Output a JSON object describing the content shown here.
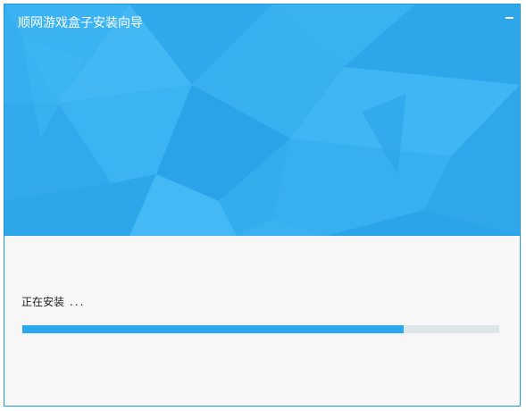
{
  "window": {
    "title": "顺网游戏盒子安装向导",
    "accent_color": "#1d9be0",
    "banner_color": "#36aef0"
  },
  "controls": {
    "minimize_icon": "minimize-icon"
  },
  "install": {
    "status_text": "正在安装",
    "status_suffix": "...",
    "progress_fraction": 0.8,
    "progress_color": "#2ca9ee",
    "track_color": "#dfe6ea"
  }
}
